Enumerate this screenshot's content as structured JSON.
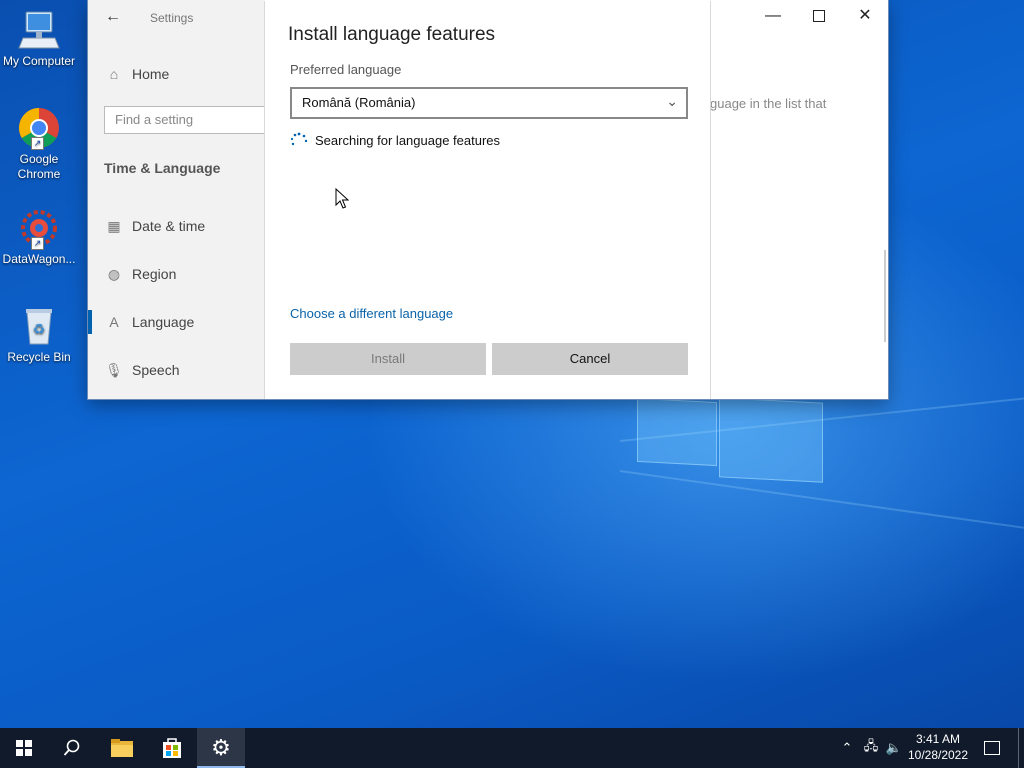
{
  "desktop": {
    "icons": [
      {
        "label": "My Computer"
      },
      {
        "label": "Google Chrome"
      },
      {
        "label": "DataWagon..."
      },
      {
        "label": "Recycle Bin"
      }
    ]
  },
  "settings": {
    "title": "Settings",
    "search_placeholder": "Find a setting",
    "home_label": "Home",
    "section_title": "Time & Language",
    "nav_items": [
      {
        "label": "Date & time",
        "icon": "calendar-clock-icon"
      },
      {
        "label": "Region",
        "icon": "globe-icon"
      },
      {
        "label": "Language",
        "icon": "language-icon",
        "selected": true
      },
      {
        "label": "Speech",
        "icon": "microphone-icon"
      }
    ],
    "background_text": "guage in the list that"
  },
  "dialog": {
    "title": "Install language features",
    "preferred_label": "Preferred language",
    "selected_language": "Română (România)",
    "status_text": "Searching for language features",
    "link_text": "Choose a different language",
    "install_label": "Install",
    "cancel_label": "Cancel"
  },
  "taskbar": {
    "time": "3:41 AM",
    "date": "10/28/2022"
  },
  "colors": {
    "accent": "#0063b1",
    "link": "#0a63a8",
    "taskbar": "#101a2a"
  }
}
